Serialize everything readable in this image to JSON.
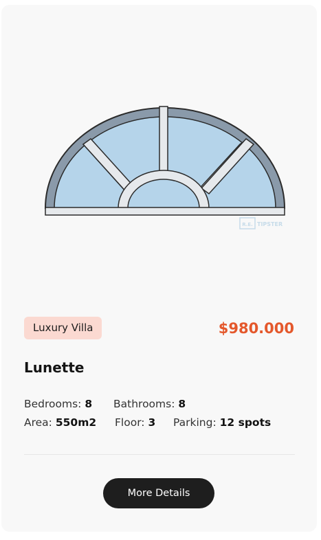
{
  "listing": {
    "image_alt": "Lunette semicircular window",
    "watermark_text": "R.E. TIPSTER",
    "category_badge": "Luxury Villa",
    "price": "$980.000",
    "title": "Lunette",
    "specs": {
      "bedrooms_label": "Bedrooms:",
      "bedrooms_value": "8",
      "bathrooms_label": "Bathrooms:",
      "bathrooms_value": "8",
      "area_label": "Area:",
      "area_value": "550m2",
      "floor_label": "Floor:",
      "floor_value": "3",
      "parking_label": "Parking:",
      "parking_value": "12 spots"
    },
    "cta_label": "More Details"
  },
  "colors": {
    "card_background": "#f8f8f8",
    "badge_background": "#fbd9d1",
    "price_accent": "#e4582c",
    "button_background": "#1e1e1e",
    "glass": "#b5d4ea",
    "frame_outer": "#8a9aaa",
    "frame_bars": "#e6e9ec"
  }
}
